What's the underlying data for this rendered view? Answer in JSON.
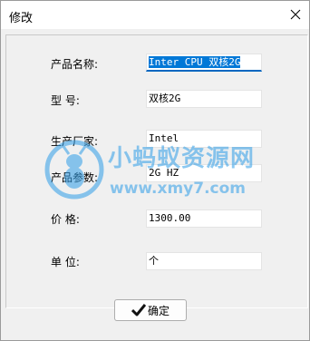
{
  "window": {
    "title": "修改"
  },
  "form": {
    "product_name_label": "产品名称:",
    "product_name_value_selected": "Inter CPU 双核2G",
    "model_label": "型    号:",
    "model_value": "双核2G",
    "manufacturer_label": "生产厂家:",
    "manufacturer_value": "Intel",
    "params_label": "产品参数:",
    "params_value": "2G HZ",
    "price_label": "价    格:",
    "price_value": "1300.00",
    "unit_label": "单    位:",
    "unit_value": "个"
  },
  "buttons": {
    "confirm_label": "确定"
  },
  "watermark": {
    "text_cn": "小蚂蚁资源网",
    "text_url": "www.xmy7.com"
  },
  "colors": {
    "selection": "#0078d7",
    "focus_underline": "#0067c0",
    "watermark": "#2f9ee8"
  }
}
